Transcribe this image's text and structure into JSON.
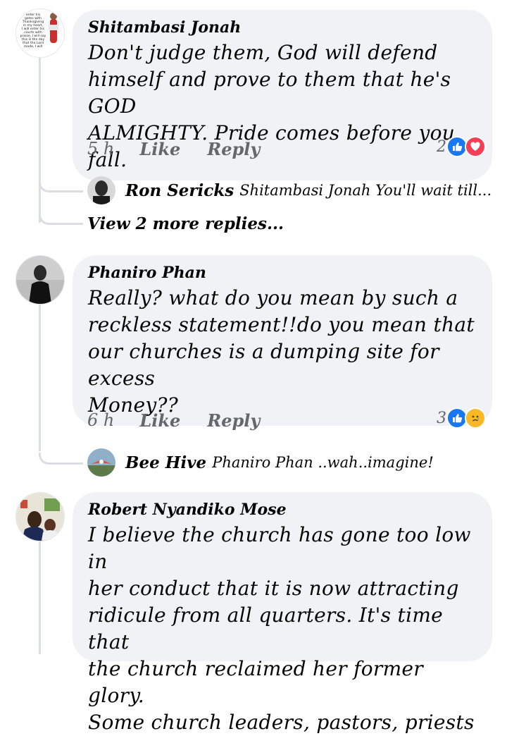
{
  "comments": [
    {
      "author": "Shitambasi Jonah",
      "lines": [
        "Don't judge them, God will defend",
        "himself and prove to them that he's GOD",
        "ALMIGHTY. Pride comes before you fall."
      ],
      "time": "5 h",
      "like": "Like",
      "reply": "Reply",
      "reactions": {
        "count": "2",
        "icons": [
          "like-icon",
          "love-icon"
        ]
      },
      "avatar_text": [
        "enter his",
        "gates with",
        "Thanksgiving",
        "in my heart,",
        "I will enter his",
        "courts with",
        "praise, I will say",
        "this is the day",
        "that the Lord",
        "made, I will"
      ],
      "replies": [
        {
          "name": "Ron Sericks",
          "text": "Shitambasi Jonah You'll wait till..."
        }
      ],
      "more_replies": "View 2 more replies..."
    },
    {
      "author": "Phaniro Phan",
      "lines": [
        "Really? what do you mean by such a",
        "reckless statement!!do you mean that",
        "our churches is a dumping site for excess",
        "Money??"
      ],
      "time": "6 h",
      "like": "Like",
      "reply": "Reply",
      "reactions": {
        "count": "3",
        "icons": [
          "like-icon",
          "sad-icon"
        ]
      },
      "replies": [
        {
          "name": "Bee Hive",
          "text": "Phaniro Phan ..wah..imagine!"
        }
      ]
    },
    {
      "author": "Robert Nyandiko Mose",
      "lines": [
        "I believe the church has gone too low in",
        "her conduct that it is now attracting",
        "ridicule from all quarters. It's time that",
        "the church reclaimed her former glory.",
        "Some church leaders, pastors, priests"
      ]
    }
  ],
  "colors": {
    "bubble": "#f0f2f5",
    "like_blue": "#1877f2",
    "love_red": "#f33e58",
    "sad_yellow": "#f7b928",
    "muted_text": "#65676b"
  }
}
